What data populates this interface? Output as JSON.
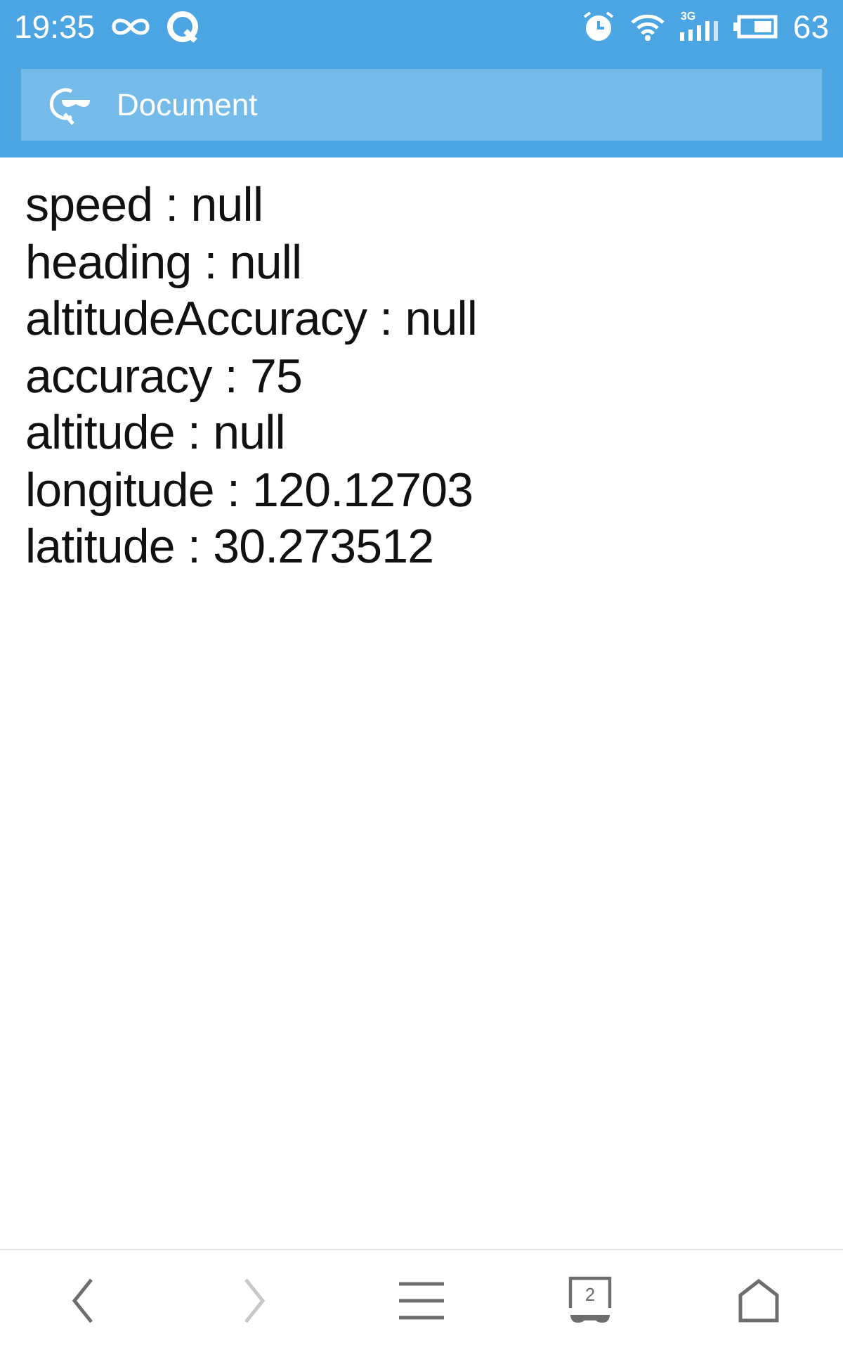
{
  "status_bar": {
    "time": "19:35",
    "network": "3G",
    "battery": "63"
  },
  "address_bar": {
    "title": "Document"
  },
  "lines": [
    "speed : null",
    "heading : null",
    "altitudeAccuracy : null",
    "accuracy : 75",
    "altitude : null",
    "longitude : 120.12703",
    "latitude : 30.273512"
  ],
  "nav_bar": [
    {
      "kind": "back",
      "disabled": false
    },
    {
      "kind": "forward",
      "disabled": true
    },
    {
      "kind": "menu",
      "disabled": false
    },
    {
      "kind": "tabs",
      "count": "2",
      "disabled": false
    },
    {
      "kind": "home",
      "disabled": false
    }
  ]
}
